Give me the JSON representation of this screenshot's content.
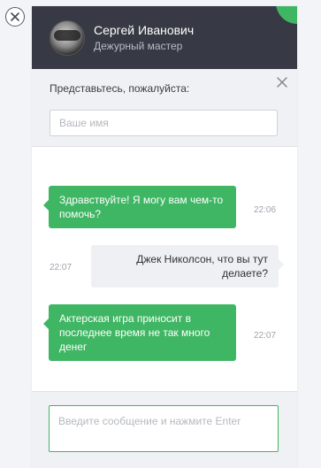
{
  "agent": {
    "name": "Сергей Иванович",
    "role": "Дежурный мастер"
  },
  "intro": {
    "label": "Представьтесь, пожалуйста:",
    "name_placeholder": "Ваше имя",
    "name_value": ""
  },
  "messages": [
    {
      "direction": "incoming",
      "text": "Здравствуйте! Я могу вам чем-то помочь?",
      "time": "22:06"
    },
    {
      "direction": "outgoing",
      "text": "Джек Николсон, что вы тут делаете?",
      "time": "22:07"
    },
    {
      "direction": "incoming",
      "text": "Актерская игра приносит в последнее время не так много денег",
      "time": "22:07"
    }
  ],
  "composer": {
    "placeholder": "Введите сообщение и нажмите Enter",
    "value": ""
  },
  "colors": {
    "header_bg": "#373a44",
    "accent_green": "#3fb663",
    "panel_bg": "#f0f1f4",
    "outgoing_bubble": "#eef0f3"
  },
  "icons": {
    "outer_close": "circle-close-icon",
    "intro_close": "close-icon"
  }
}
